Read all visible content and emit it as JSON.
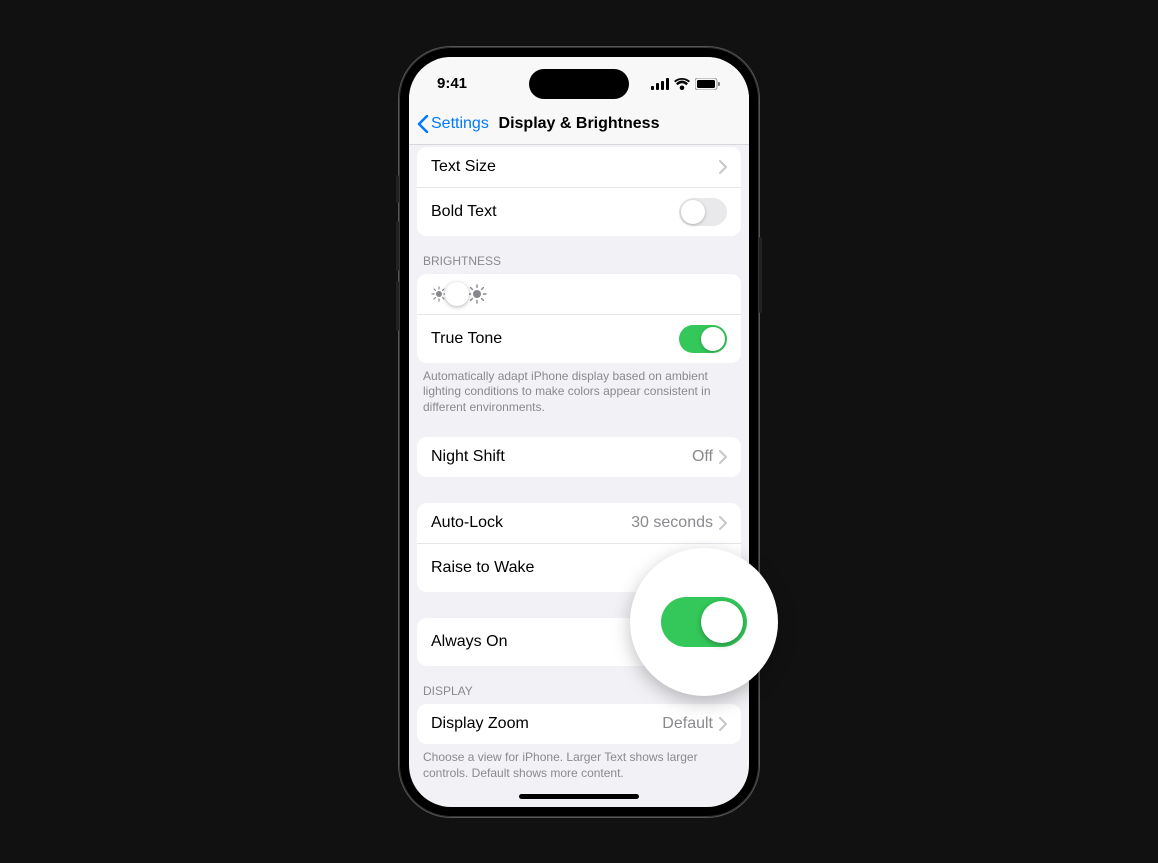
{
  "status": {
    "time": "9:41"
  },
  "nav": {
    "back": "Settings",
    "title": "Display & Brightness"
  },
  "rows": {
    "text_size": "Text Size",
    "bold_text": "Bold Text",
    "true_tone": "True Tone",
    "night_shift": "Night Shift",
    "night_shift_value": "Off",
    "auto_lock": "Auto-Lock",
    "auto_lock_value": "30 seconds",
    "raise_to_wake": "Raise to Wake",
    "always_on": "Always On",
    "display_zoom": "Display Zoom",
    "display_zoom_value": "Default"
  },
  "sections": {
    "brightness": "BRIGHTNESS",
    "display": "DISPLAY"
  },
  "footers": {
    "true_tone": "Automatically adapt iPhone display based on ambient lighting conditions to make colors appear consistent in different environments.",
    "display_zoom": "Choose a view for iPhone. Larger Text shows larger controls. Default shows more content."
  },
  "toggles": {
    "bold_text": false,
    "true_tone": true,
    "raise_to_wake": true,
    "always_on": true
  },
  "brightness_value": 45,
  "colors": {
    "accent": "#007aff",
    "toggle_on": "#34c759"
  }
}
